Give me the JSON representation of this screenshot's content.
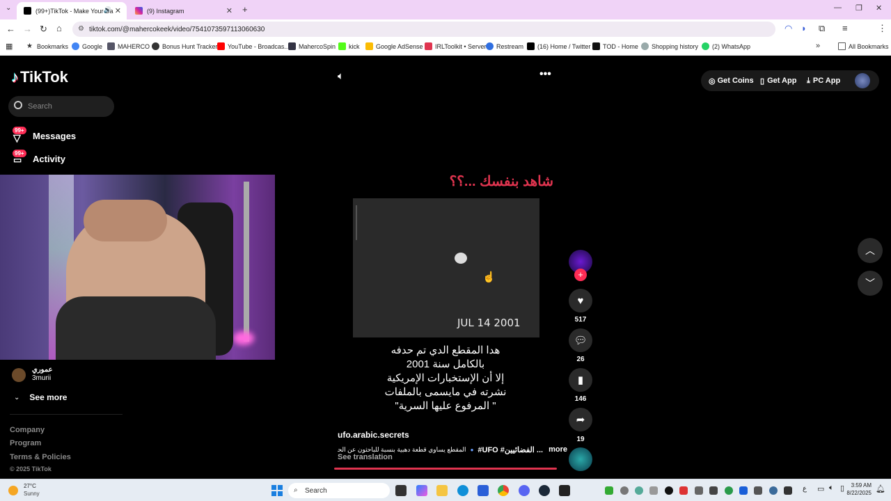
{
  "browser": {
    "tabs": [
      {
        "title": "(99+)TikTok - Make Your Da",
        "active": true
      },
      {
        "title": "(9) Instagram",
        "active": false
      }
    ],
    "url": "tiktok.com/@mahercokeek/video/7541073597113060630",
    "bookmarks": [
      "Bookmarks",
      "Google",
      "MAHERCO",
      "Bonus Hunt Tracker",
      "YouTube - Broadcas...",
      "MahercoSpin",
      "kick",
      "Google AdSense",
      "IRLToolkit • Server",
      "Restream",
      "(16) Home / Twitter",
      "TOD - Home",
      "Shopping history",
      "(2) WhatsApp"
    ],
    "all_bookmarks": "All Bookmarks"
  },
  "tiktok": {
    "logo": "TikTok",
    "search_placeholder": "Search",
    "nav": {
      "messages": "Messages",
      "activity": "Activity",
      "badge": "99+"
    },
    "suggested": {
      "name": "عموري",
      "handle": "3murii",
      "see_more": "See more"
    },
    "footer": [
      "Company",
      "Program",
      "Terms & Policies",
      "© 2025 TikTok"
    ],
    "header_buttons": {
      "get_coins": "Get Coins",
      "get_app": "Get App",
      "pc_app": "PC App"
    },
    "video": {
      "headline": "شاهد بنفسك ...؟؟",
      "date_stamp": "JUL 14 2001",
      "caption_lines": [
        "هدا المقطع الدي تم حدفه",
        "بالكامل سنة 2001",
        "إلا أن الإستخبارات الإمريكية",
        "نشرته في مايسمى بالملفات",
        "\" المرفوع عليها السرية\""
      ],
      "author": "ufo.arabic.secrets",
      "description": "المقطع يساوي قطعة دهبية بنسبة للباحثون عن الحقيقة",
      "hashtags": "#UFO  #الفضائيين ...",
      "more": "more",
      "see_translation": "See translation"
    },
    "actions": {
      "likes": "517",
      "comments": "26",
      "saves": "146",
      "shares": "19"
    }
  },
  "taskbar": {
    "weather_temp": "27°C",
    "weather_desc": "Sunny",
    "search": "Search",
    "time": "3:59 AM",
    "date": "8/22/2025"
  },
  "colors": {
    "tiktok_red": "#fe2c55",
    "headline_red": "#e0344f",
    "tab_strip": "#f0d3f7"
  }
}
